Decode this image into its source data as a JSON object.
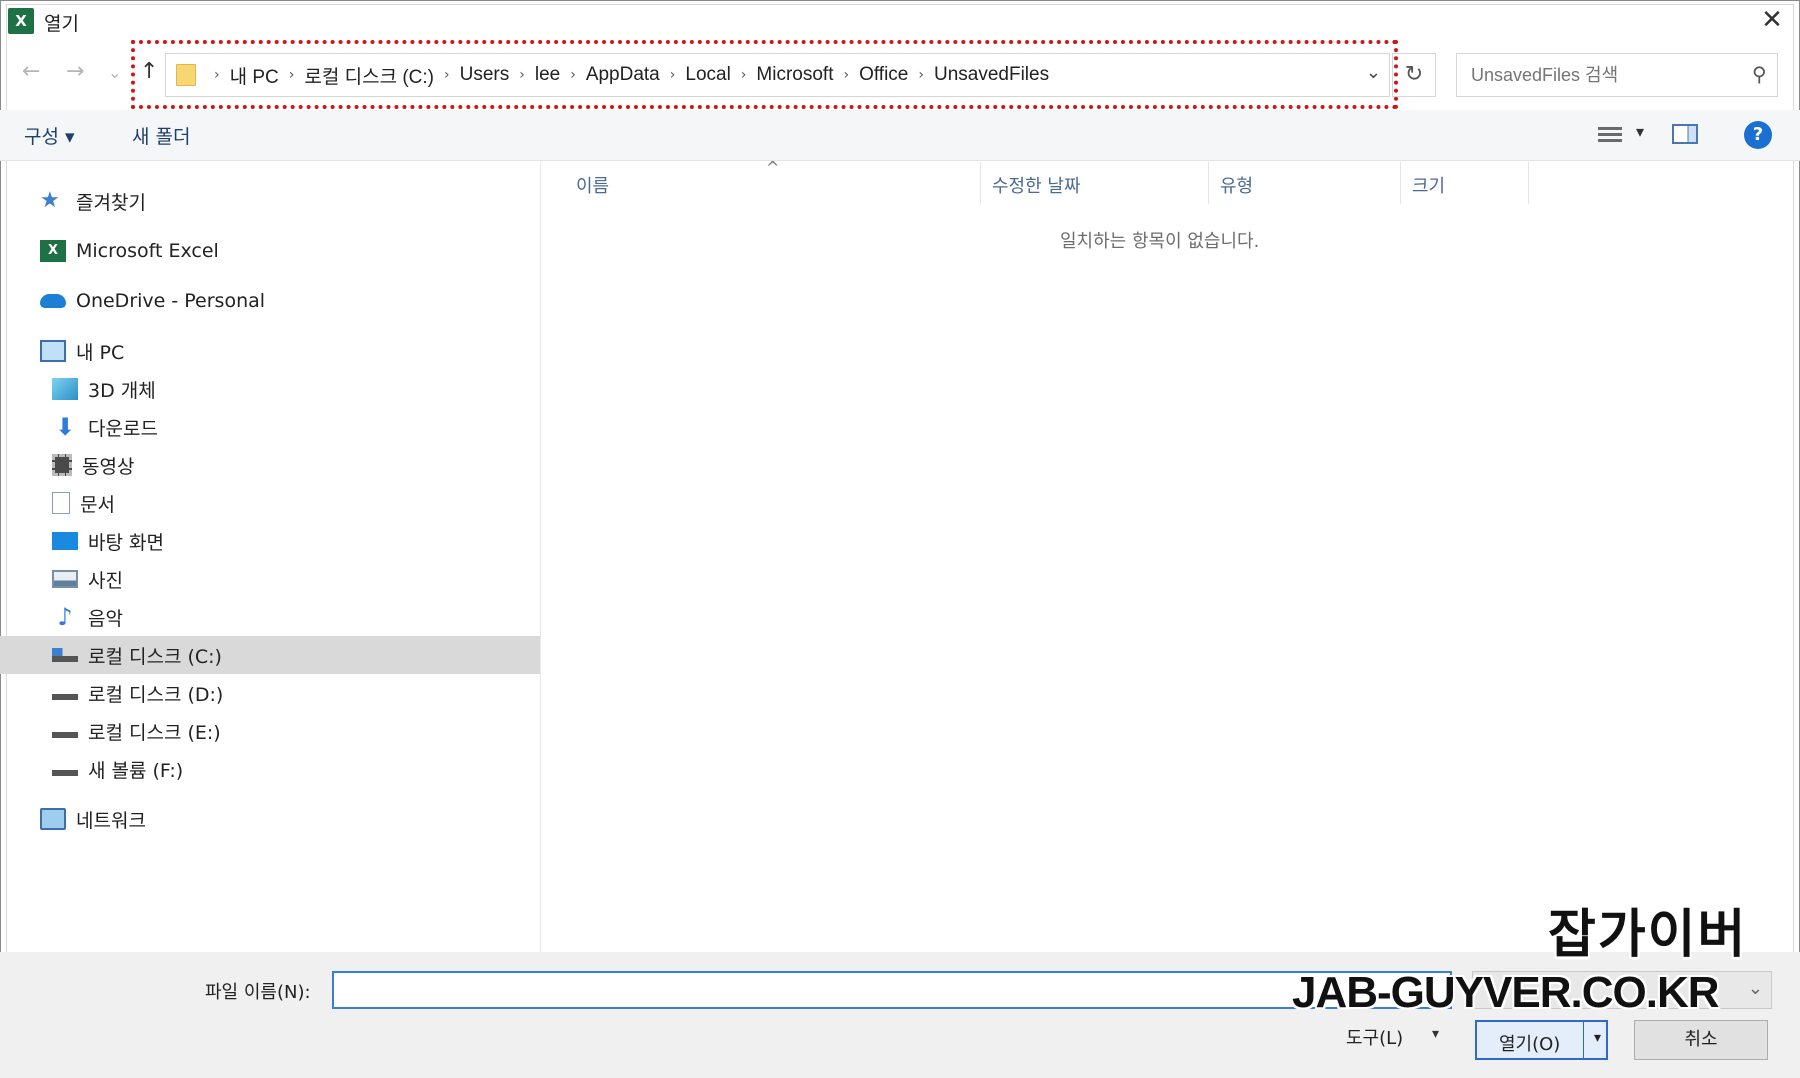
{
  "window": {
    "title": "열기",
    "app_icon_letter": "X",
    "close_glyph": "✕"
  },
  "nav": {
    "back_glyph": "←",
    "forward_glyph": "→",
    "recent_glyph": "⌄",
    "up_glyph": "↑",
    "refresh_glyph": "↻"
  },
  "address": {
    "crumbs": [
      "내 PC",
      "로컬 디스크 (C:)",
      "Users",
      "lee",
      "AppData",
      "Local",
      "Microsoft",
      "Office",
      "UnsavedFiles"
    ],
    "separator": "›",
    "dropdown_glyph": "⌄"
  },
  "search": {
    "placeholder": "UnsavedFiles 검색"
  },
  "toolbar": {
    "organize_label": "구성 ▾",
    "new_folder_label": "새 폴더",
    "view_dropdown_glyph": "▾",
    "help_label": "?"
  },
  "sidebar": {
    "items": [
      {
        "label": "즐겨찾기",
        "icon": "star-icon"
      },
      {
        "label": "Microsoft Excel",
        "icon": "excel-icon"
      },
      {
        "label": "OneDrive - Personal",
        "icon": "cloud-icon"
      },
      {
        "label": "내 PC",
        "icon": "computer-icon"
      },
      {
        "label": "3D 개체",
        "icon": "cube-icon"
      },
      {
        "label": "다운로드",
        "icon": "download-icon"
      },
      {
        "label": "동영상",
        "icon": "video-icon"
      },
      {
        "label": "문서",
        "icon": "document-icon"
      },
      {
        "label": "바탕 화면",
        "icon": "desktop-icon"
      },
      {
        "label": "사진",
        "icon": "picture-icon"
      },
      {
        "label": "음악",
        "icon": "music-icon"
      },
      {
        "label": "로컬 디스크 (C:)",
        "icon": "drive-icon",
        "selected": true
      },
      {
        "label": "로컬 디스크 (D:)",
        "icon": "drive-icon"
      },
      {
        "label": "로컬 디스크 (E:)",
        "icon": "drive-icon"
      },
      {
        "label": "새 볼륨 (F:)",
        "icon": "drive-icon"
      },
      {
        "label": "네트워크",
        "icon": "network-icon"
      }
    ]
  },
  "filelist": {
    "columns": [
      "이름",
      "수정한 날짜",
      "유형",
      "크기"
    ],
    "sort_glyph": "^",
    "empty_message": "일치하는 항목이 없습니다."
  },
  "footer": {
    "filename_label": "파일 이름(N):",
    "filename_value": "",
    "tools_label": "도구(L)",
    "tools_dropdown_glyph": "▾",
    "open_label": "열기(O)",
    "open_split_glyph": "▾",
    "cancel_label": "취소",
    "filter_chevron": "⌄"
  },
  "watermark": {
    "title": "잡가이버",
    "url": "JAB-GUYVER.CO.KR"
  },
  "colors": {
    "accent": "#2d6bc4",
    "highlight_border": "#d01616",
    "selected_bg": "#d9d9d9",
    "excel_green": "#1e7145"
  }
}
